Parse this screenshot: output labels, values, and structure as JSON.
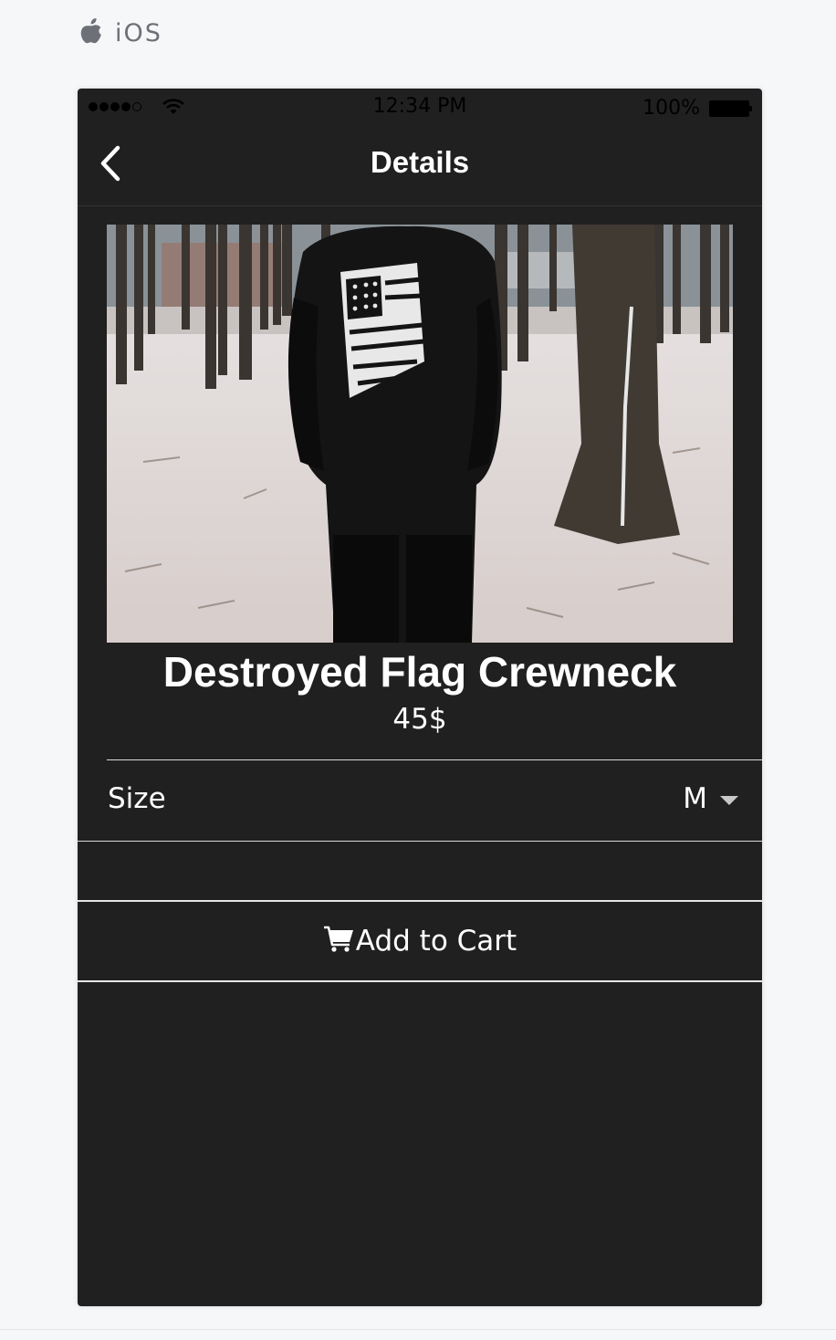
{
  "platform": {
    "label": "iOS",
    "icon": "apple-logo-icon"
  },
  "status_bar": {
    "time": "12:34 PM",
    "battery_label": "100%",
    "signal_bars_filled": 4,
    "signal_bars_total": 5,
    "battery_level": 1.0
  },
  "nav": {
    "title": "Details",
    "back_icon": "chevron-left-icon"
  },
  "product": {
    "name": "Destroyed Flag Crewneck",
    "price": "45$"
  },
  "options": {
    "size_label": "Size",
    "size_value": "M",
    "caret_icon": "caret-down-icon"
  },
  "actions": {
    "add_to_cart_label": "Add to Cart",
    "cart_icon": "shopping-cart-icon"
  },
  "colors": {
    "screen_background": "#202020",
    "page_background": "#f6f7f9",
    "text": "#ffffff",
    "divider": "#d9d9d9"
  }
}
